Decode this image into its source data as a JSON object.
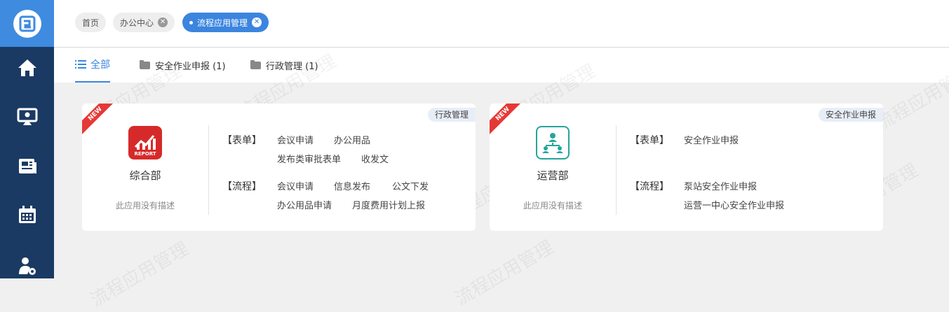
{
  "sidebar": {
    "logo": "app-logo-icon",
    "items": [
      {
        "icon": "home-icon"
      },
      {
        "icon": "monitor-user-icon"
      },
      {
        "icon": "news-icon"
      },
      {
        "icon": "calendar-icon"
      },
      {
        "icon": "user-settings-icon"
      }
    ]
  },
  "top_tabs": [
    {
      "label": "首页"
    },
    {
      "label": "办公中心"
    },
    {
      "label": "流程应用管理"
    }
  ],
  "category_tabs": [
    {
      "label": "全部"
    },
    {
      "label": "安全作业申报 (1)"
    },
    {
      "label": "行政管理 (1)"
    }
  ],
  "cards": [
    {
      "new_label": "NEW",
      "category": "行政管理",
      "icon_text": "REPORT",
      "name": "综合部",
      "description": "此应用没有描述",
      "forms_label": "【表单】",
      "forms": [
        "会议申请",
        "办公用品",
        "发布类审批表单",
        "收发文"
      ],
      "flows_label": "【流程】",
      "flows": [
        "会议申请",
        "信息发布",
        "公文下发",
        "办公用品申请",
        "月度费用计划上报"
      ]
    },
    {
      "new_label": "NEW",
      "category": "安全作业申报",
      "name": "运营部",
      "description": "此应用没有描述",
      "forms_label": "【表单】",
      "forms": [
        "安全作业申报"
      ],
      "flows_label": "【流程】",
      "flows": [
        "泵站安全作业申报",
        "运营一中心安全作业申报"
      ]
    }
  ],
  "watermark": "流程应用管理",
  "colors": {
    "sidebar": "#1a3a63",
    "accent": "#3b85df",
    "new_tag": "#e53935"
  }
}
